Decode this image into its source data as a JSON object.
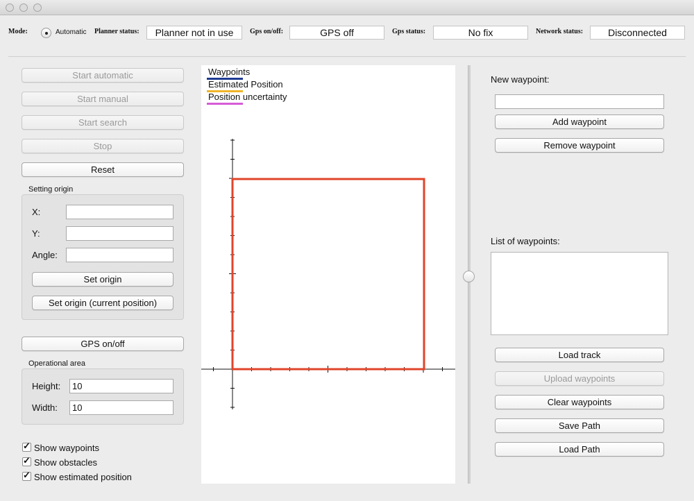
{
  "statusbar": {
    "mode_label": "Mode:",
    "mode_value": "Automatic",
    "planner_label": "Planner status:",
    "planner_value": "Planner not in use",
    "gps_onoff_label": "Gps on/off:",
    "gps_onoff_value": "GPS off",
    "gps_status_label": "Gps status:",
    "gps_status_value": "No fix",
    "network_label": "Network status:",
    "network_value": "Disconnected"
  },
  "controls": {
    "start_automatic": "Start automatic",
    "start_manual": "Start manual",
    "start_search": "Start search",
    "stop": "Stop",
    "reset": "Reset"
  },
  "origin": {
    "title": "Setting origin",
    "x_label": "X:",
    "x_value": "",
    "y_label": "Y:",
    "y_value": "",
    "angle_label": "Angle:",
    "angle_value": "",
    "set_origin": "Set origin",
    "set_origin_current": "Set origin (current position)"
  },
  "gps_button": "GPS on/off",
  "area": {
    "title": "Operational area",
    "height_label": "Height:",
    "height_value": "10",
    "width_label": "Width:",
    "width_value": "10"
  },
  "checks": {
    "show_waypoints": "Show waypoints",
    "show_obstacles": "Show obstacles",
    "show_estimated": "Show estimated position"
  },
  "legend": [
    {
      "label": "Waypoints",
      "color": "#1f3a93"
    },
    {
      "label": "Estimated Position",
      "color": "#f0b429"
    },
    {
      "label": "Position uncertainty",
      "color": "#d65bd6"
    }
  ],
  "plot": {
    "area_color": "#e0442a",
    "area_height": 10,
    "area_width": 10
  },
  "waypoints": {
    "new_label": "New waypoint:",
    "new_value": "",
    "add": "Add waypoint",
    "remove": "Remove waypoint",
    "list_label": "List of waypoints:",
    "items": [],
    "load_track": "Load track",
    "upload": "Upload waypoints",
    "clear": "Clear waypoints",
    "save_path": "Save Path",
    "load_path": "Load Path"
  }
}
